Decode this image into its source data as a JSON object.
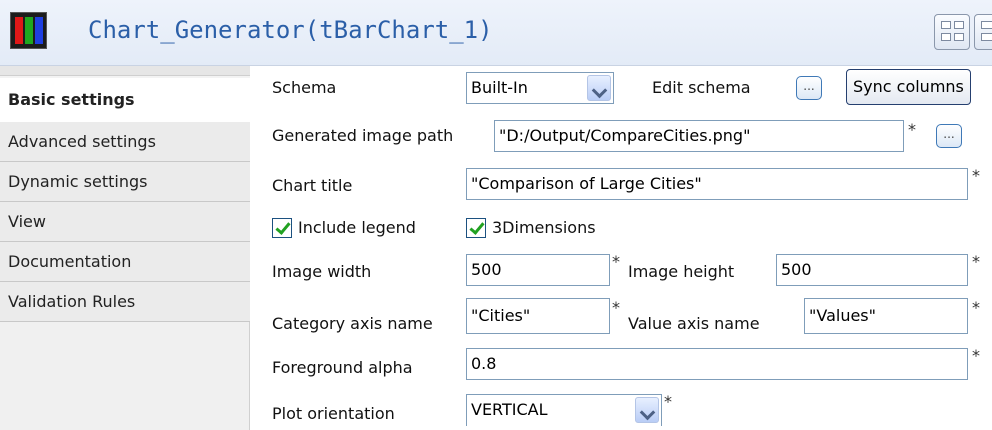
{
  "header": {
    "title": "Chart_Generator(tBarChart_1)",
    "icon": "bar-chart-app-icon"
  },
  "sidebar": {
    "items": [
      {
        "label": "Basic settings",
        "active": true
      },
      {
        "label": "Advanced settings",
        "active": false
      },
      {
        "label": "Dynamic settings",
        "active": false
      },
      {
        "label": "View",
        "active": false
      },
      {
        "label": "Documentation",
        "active": false
      },
      {
        "label": "Validation Rules",
        "active": false
      }
    ]
  },
  "form": {
    "schema": {
      "label": "Schema",
      "value": "Built-In",
      "edit_label": "Edit schema",
      "dots": "...",
      "sync_label": "Sync columns"
    },
    "image_path": {
      "label": "Generated image path",
      "value": "\"D:/Output/CompareCities.png\"",
      "required": "*",
      "dots": "..."
    },
    "chart_title": {
      "label": "Chart title",
      "value": "\"Comparison of Large Cities\"",
      "required": "*"
    },
    "include_legend": {
      "label": "Include legend",
      "checked": true
    },
    "three_dimensions": {
      "label": "3Dimensions",
      "checked": true
    },
    "image_width": {
      "label": "Image width",
      "value": "500",
      "required": "*"
    },
    "image_height": {
      "label": "Image height",
      "value": "500",
      "required": "*"
    },
    "category_axis": {
      "label": "Category axis name",
      "value": "\"Cities\"",
      "required": "*"
    },
    "value_axis": {
      "label": "Value axis name",
      "value": "\"Values\"",
      "required": "*"
    },
    "foreground_alpha": {
      "label": "Foreground alpha",
      "value": "0.8",
      "required": "*"
    },
    "plot_orientation": {
      "label": "Plot orientation",
      "value": "VERTICAL",
      "required": "*"
    }
  },
  "colors": {
    "title": "#2b5fa8",
    "field_border": "#7f9db9",
    "check": "#21a121"
  }
}
